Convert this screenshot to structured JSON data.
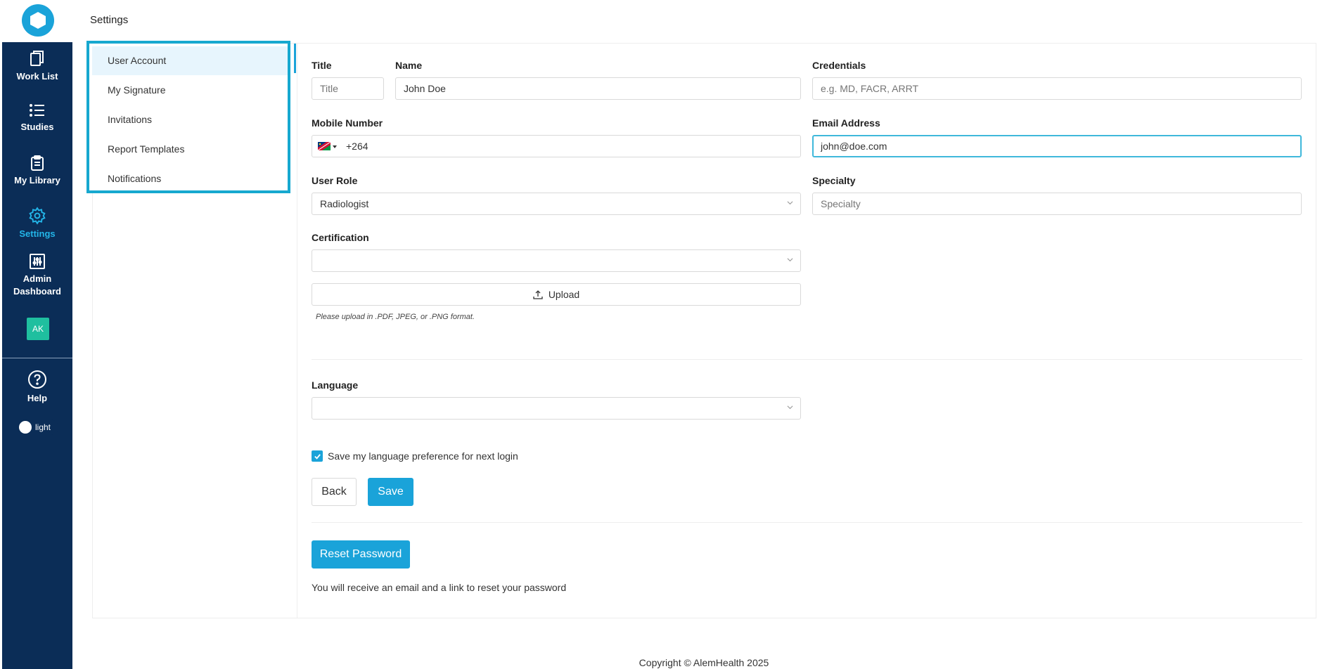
{
  "app": {
    "page_title": "Settings",
    "footer": "Copyright © AlemHealth 2025"
  },
  "sidebar": {
    "items": [
      {
        "label": "Work List",
        "icon": "copy-icon"
      },
      {
        "label": "Studies",
        "icon": "list-icon"
      },
      {
        "label": "My Library",
        "icon": "clipboard-icon"
      },
      {
        "label": "Settings",
        "icon": "gear-icon",
        "active": true
      },
      {
        "label": "Admin Dashboard",
        "icon": "sliders-icon"
      }
    ],
    "avatar": "AK",
    "help": "Help",
    "theme_toggle": "light"
  },
  "settings_menu": {
    "items": [
      "User Account",
      "My Signature",
      "Invitations",
      "Report Templates",
      "Notifications"
    ],
    "active": "User Account"
  },
  "form": {
    "title": {
      "label": "Title",
      "placeholder": "Title",
      "value": ""
    },
    "name": {
      "label": "Name",
      "value": "John Doe"
    },
    "credentials": {
      "label": "Credentials",
      "placeholder": "e.g. MD, FACR, ARRT",
      "value": ""
    },
    "mobile": {
      "label": "Mobile Number",
      "value": "+264",
      "country_flag": "namibia-flag-icon"
    },
    "email": {
      "label": "Email Address",
      "value": "john@doe.com"
    },
    "user_role": {
      "label": "User Role",
      "value": "Radiologist"
    },
    "specialty": {
      "label": "Specialty",
      "placeholder": "Specialty",
      "value": ""
    },
    "certification": {
      "label": "Certification",
      "value": ""
    },
    "upload": {
      "label": "Upload",
      "hint": "Please upload in .PDF, JPEG, or .PNG format."
    },
    "language": {
      "label": "Language",
      "value": ""
    },
    "save_language": {
      "label": "Save my language preference for next login",
      "checked": true
    },
    "back_button": "Back",
    "save_button": "Save",
    "reset_password_button": "Reset Password",
    "reset_note": "You will receive an email and a link to reset your password"
  },
  "colors": {
    "sidebar_bg": "#0b2d57",
    "accent": "#1aa3d9",
    "highlight_border": "#17a8cf",
    "avatar_bg": "#1fbf9f"
  }
}
